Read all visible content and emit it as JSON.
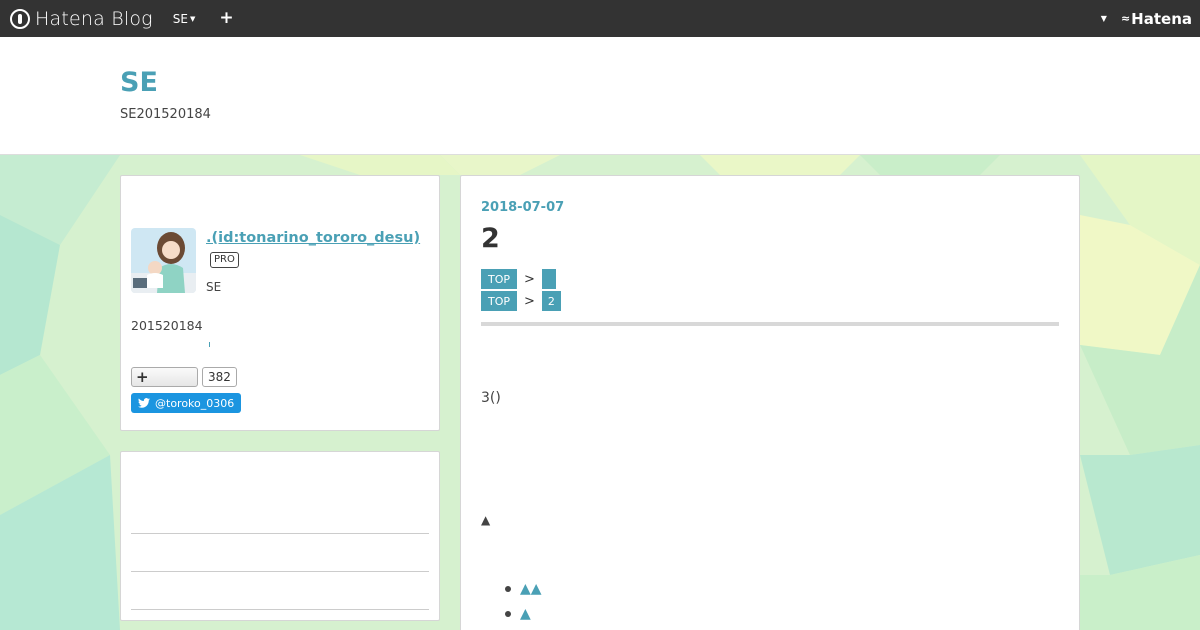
{
  "nav": {
    "brand": "Hatena Blog",
    "blog_menu": "SE",
    "plus": "+",
    "right_logo": "Hatena"
  },
  "header": {
    "title": "SE",
    "description": "SE201520184"
  },
  "profile": {
    "name": ".(id:tonarino_tororo_desu)",
    "badge": "PRO",
    "job": "SE",
    "number": "201520184",
    "follow_icon": "+",
    "follow_count": "382",
    "twitter": "@toroko_0306"
  },
  "entry": {
    "date": "2018-07-07",
    "title": "2",
    "breadcrumbs": [
      {
        "top": "TOP",
        "sep": ">",
        "tag": ""
      },
      {
        "top": "TOP",
        "sep": ">",
        "tag": "2"
      }
    ],
    "body": "3()",
    "section_marker": "▲",
    "toc": [
      "▲▲",
      "▲"
    ]
  },
  "colors": {
    "accent": "#4aa0b5",
    "nav_bg": "#333333",
    "twitter": "#1b95e0"
  }
}
